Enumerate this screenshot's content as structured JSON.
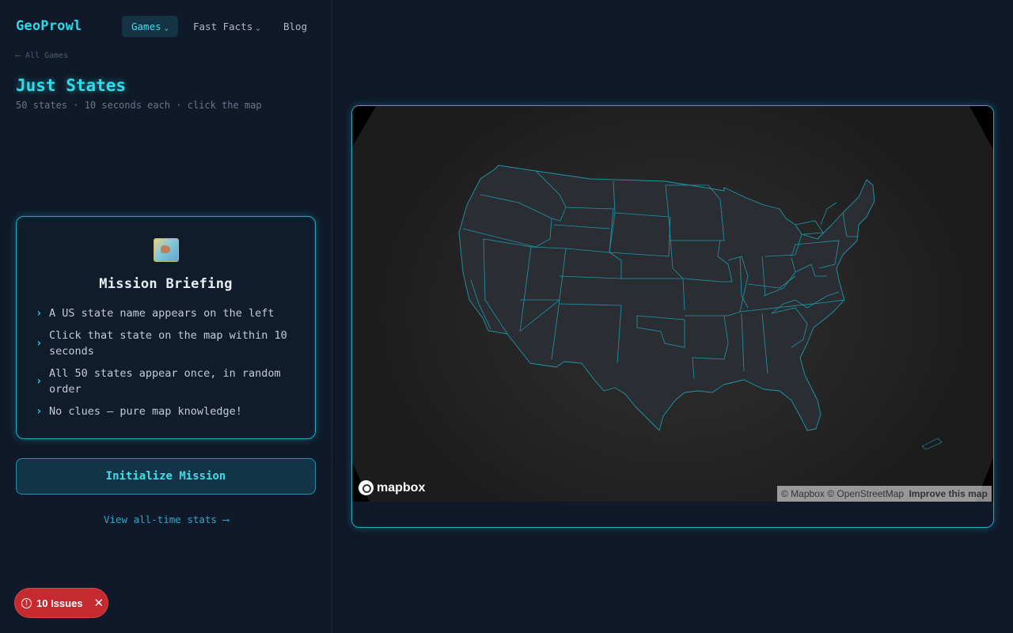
{
  "brand": {
    "name": "GeoProwl"
  },
  "nav": {
    "items": [
      {
        "label": "Games",
        "has_dropdown": true,
        "active": true
      },
      {
        "label": "Fast Facts",
        "has_dropdown": true,
        "active": false
      },
      {
        "label": "Blog",
        "has_dropdown": false,
        "active": false
      }
    ]
  },
  "breadcrumb": {
    "back_label": "⟵ All Games"
  },
  "page": {
    "title": "Just States",
    "subtitle": "50 states · 10 seconds each · click the map"
  },
  "briefing": {
    "icon": "world-map-icon",
    "title": "Mission Briefing",
    "items": [
      "A US state name appears on the left",
      "Click that state on the map within 10 seconds",
      "All 50 states appear once, in random order",
      "No clues — pure map knowledge!"
    ]
  },
  "actions": {
    "start_label": "Initialize Mission",
    "stats_label": "View all-time stats ⟶"
  },
  "issues": {
    "label": "10 Issues",
    "count": 10
  },
  "map": {
    "logo": "mapbox",
    "attribution": "© Mapbox © OpenStreetMap",
    "improve_label": "Improve this map"
  },
  "colors": {
    "accent": "#2fd8e6",
    "background": "#0e1828",
    "state_outline": "#1e9cae",
    "issues_badge": "#c52a2f"
  }
}
